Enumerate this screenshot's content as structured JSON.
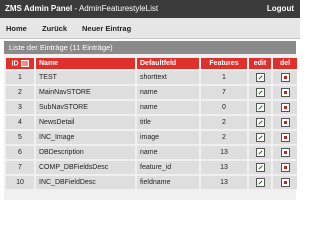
{
  "header": {
    "app_name": "ZMS Admin Panel",
    "separator": " - ",
    "page_name": "AdminFeaturestyleList",
    "logout_label": "Logout"
  },
  "nav": {
    "items": [
      {
        "label": "Home"
      },
      {
        "label": "Zurück"
      },
      {
        "label": "Neuer Eintrag"
      }
    ]
  },
  "panel": {
    "title": "Liste der Einträge (11 Einträge)"
  },
  "table": {
    "columns": {
      "id": "ID",
      "name": "Name",
      "default_field": "Defaultfeld",
      "features": "Features",
      "edit": "edit",
      "del": "del"
    },
    "rows": [
      {
        "id": "1",
        "name": "TEST",
        "default_field": "shorttext",
        "features": "1"
      },
      {
        "id": "2",
        "name": "MainNavSTORE",
        "default_field": "name",
        "features": "7"
      },
      {
        "id": "3",
        "name": "SubNavSTORE",
        "default_field": "name",
        "features": "0"
      },
      {
        "id": "4",
        "name": "NewsDetail",
        "default_field": "title",
        "features": "2"
      },
      {
        "id": "5",
        "name": "INC_Image",
        "default_field": "image",
        "features": "2"
      },
      {
        "id": "6",
        "name": "DBDescription",
        "default_field": "name",
        "features": "13"
      },
      {
        "id": "7",
        "name": "COMP_DBFieldsDesc",
        "default_field": "feature_id",
        "features": "13"
      },
      {
        "id": "10",
        "name": "INC_DBFieldDesc",
        "default_field": "fieldname",
        "features": "13"
      }
    ]
  },
  "colors": {
    "topbar": "#3b3b3b",
    "header_red": "#e0302c",
    "row_bg": "#dedede"
  }
}
